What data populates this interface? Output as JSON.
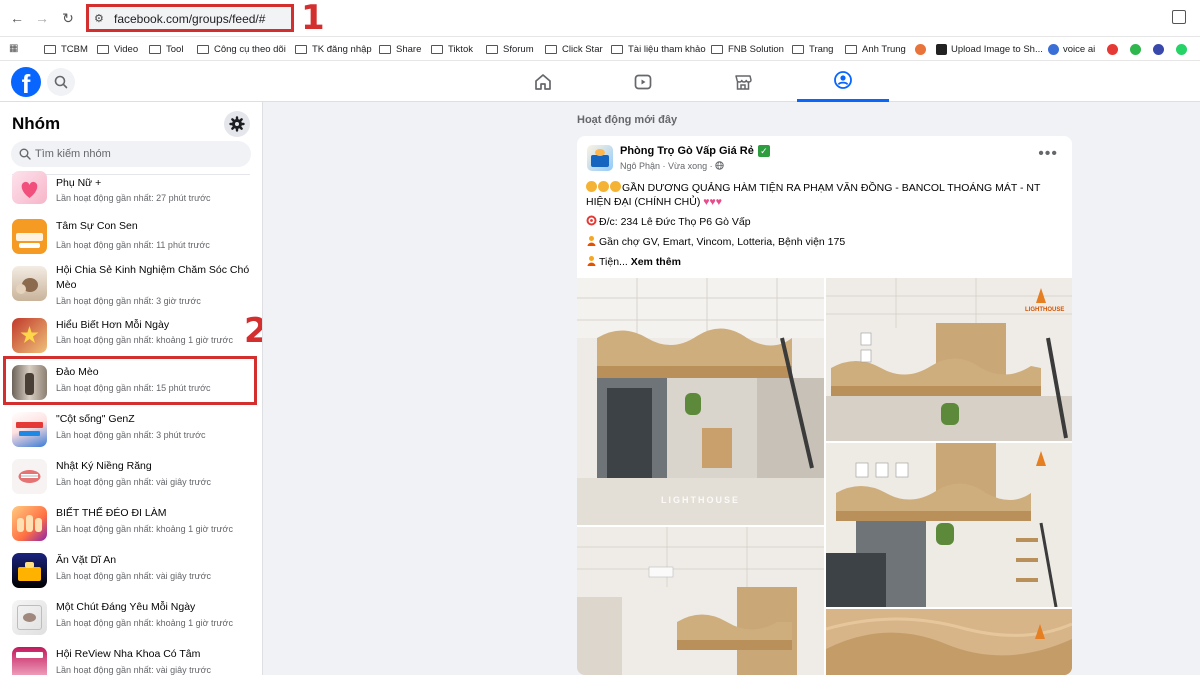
{
  "browser": {
    "url": "facebook.com/groups/feed/#",
    "bookmarks": [
      {
        "label": "TCBM",
        "type": "folder"
      },
      {
        "label": "Video",
        "type": "folder"
      },
      {
        "label": "Tool",
        "type": "folder"
      },
      {
        "label": "Công cụ theo dõi",
        "type": "folder"
      },
      {
        "label": "TK đăng nhập",
        "type": "folder"
      },
      {
        "label": "Share",
        "type": "folder"
      },
      {
        "label": "Tiktok",
        "type": "folder"
      },
      {
        "label": "Sforum",
        "type": "folder"
      },
      {
        "label": "Click Star",
        "type": "folder"
      },
      {
        "label": "Tài liệu tham khảo",
        "type": "folder"
      },
      {
        "label": "FNB Solution",
        "type": "folder"
      },
      {
        "label": "Trang",
        "type": "folder"
      },
      {
        "label": "Anh Trung",
        "type": "folder"
      },
      {
        "label": "Upload Image to Sh...",
        "type": "site"
      },
      {
        "label": "voice ai",
        "type": "site"
      }
    ]
  },
  "annotations": {
    "marker_1": "1",
    "marker_2": "2"
  },
  "sidebar": {
    "title": "Nhóm",
    "search_placeholder": "Tìm kiếm nhóm",
    "groups": [
      {
        "name": "Phụ Nữ +",
        "activity": "Lần hoạt động gần nhất: 27 phút trước"
      },
      {
        "name": "Tâm Sự Con Sen",
        "activity": "Lần hoạt động gần nhất: 11 phút trước"
      },
      {
        "name": "Hội Chia Sẻ Kinh Nghiệm Chăm Sóc Chó Mèo",
        "activity": "Lần hoạt động gần nhất: 3 giờ trước"
      },
      {
        "name": "Hiểu Biết Hơn Mỗi Ngày",
        "activity": "Lần hoạt động gần nhất: khoảng 1 giờ trước"
      },
      {
        "name": "Đảo Mèo",
        "activity": "Lần hoạt động gần nhất: 15 phút trước"
      },
      {
        "name": "\"Cột sống\" GenZ",
        "activity": "Lần hoạt động gần nhất: 3 phút trước"
      },
      {
        "name": "Nhật Ký Niềng Răng",
        "activity": "Lần hoạt động gần nhất: vài giây trước"
      },
      {
        "name": "BIẾT THẾ ĐÉO ĐI LÀM",
        "activity": "Lần hoạt động gần nhất: khoảng 1 giờ trước"
      },
      {
        "name": "Ăn Vặt Dĩ An",
        "activity": "Lần hoạt động gần nhất: vài giây trước"
      },
      {
        "name": "Một Chút Đáng Yêu Mỗi Ngày",
        "activity": "Lần hoạt động gần nhất: khoảng 1 giờ trước"
      },
      {
        "name": "Hội ReView Nha Khoa Có Tâm",
        "activity": "Lần hoạt động gần nhất: vài giây trước"
      }
    ]
  },
  "feed": {
    "heading": "Hoạt động mới đây",
    "post": {
      "group_name": "Phòng Trọ Gò Vấp Giá Rẻ",
      "author": "Ngô Phận",
      "time": "Vừa xong",
      "line1": "GẦN DƯƠNG QUẢNG HÀM TIỆN RA PHẠM VĂN ĐỒNG - BANCOL THOÁNG MÁT - NT HIỆN ĐẠI (CHÍNH CHỦ)",
      "line2": "Đ/c: 234 Lê Đức Thọ P6 Gò Vấp",
      "line3": "Gần chợ GV, Emart, Vincom, Lotteria, Bệnh viện 175",
      "line4": "Tiện...",
      "see_more": "Xem thêm",
      "watermark": "LIGHTHOUSE",
      "brand_small": "LIGHTHOUSE"
    }
  },
  "colors": {
    "fb_blue": "#0866ff",
    "annotation_red": "#d32f2f"
  }
}
